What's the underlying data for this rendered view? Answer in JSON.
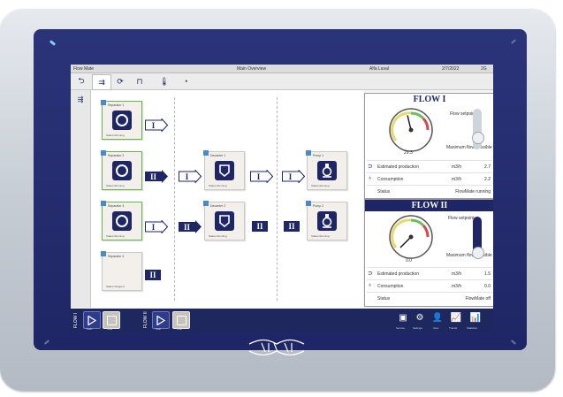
{
  "titlebar": {
    "left": "Flow Mate",
    "center": "Main Overview",
    "user": "Alfa Laval",
    "time": "2/7/2022",
    "signal": "2G"
  },
  "units": [
    {
      "title": "Separator 1",
      "footer": "Status  Running"
    },
    {
      "title": "Separator 2",
      "footer": "Status  Running"
    },
    {
      "title": "Separator 3",
      "footer": "Status  Running"
    },
    {
      "title": "Separator 4",
      "footer": "Status  Stopped"
    },
    {
      "title": "Decanter 1",
      "footer": "Status  Running"
    },
    {
      "title": "Decanter 2",
      "footer": "Status  Running"
    },
    {
      "title": "Pump 1",
      "footer": "Status  Running"
    },
    {
      "title": "Pump 2",
      "footer": "Status  Running"
    }
  ],
  "arrows": {
    "one": "I",
    "two": "II"
  },
  "flow1": {
    "title": "FLOW I",
    "gauge_value": "29.3",
    "gauge_level": 0.45,
    "slider_level": 0.25,
    "slider_top_label": "Flow setpoint",
    "slider_bottom_label": "Maximum flow possible",
    "rows": [
      {
        "icon": "flow-icon",
        "label": "Estimated production",
        "unit": "m3/h",
        "value": "2.7"
      },
      {
        "icon": "consumption-icon",
        "label": "Consumption",
        "unit": "m3/h",
        "value": "2.2"
      },
      {
        "icon": "",
        "label": "Status",
        "unit": "",
        "value": "FlowMate running"
      }
    ]
  },
  "flow2": {
    "title": "FLOW II",
    "gauge_value": "0.0",
    "gauge_level": 0.0,
    "slider_level": 0.0,
    "slider_top_label": "Flow setpoint",
    "slider_bottom_label": "Maximum flow possible",
    "rows": [
      {
        "icon": "flow-icon",
        "label": "Estimated production",
        "unit": "m3/h",
        "value": "1.5"
      },
      {
        "icon": "consumption-icon",
        "label": "Consumption",
        "unit": "m3/h",
        "value": "0.0"
      },
      {
        "icon": "",
        "label": "Status",
        "unit": "",
        "value": "FlowMate off"
      }
    ]
  },
  "bottom": {
    "flow1_label": "FLOW I",
    "flow2_label": "FLOW II",
    "start_label": "Start",
    "stop_label": "Stop",
    "right": [
      {
        "icon": "service-icon",
        "label": "Service"
      },
      {
        "icon": "settings-icon",
        "label": "Settings"
      },
      {
        "icon": "user-icon",
        "label": "User"
      },
      {
        "icon": "trend-icon",
        "label": "Trends"
      },
      {
        "icon": "chart-icon",
        "label": "Statistics"
      }
    ]
  },
  "colors": {
    "navy": "#1e2666",
    "green": "#67b44a",
    "accent": "#4a8ac9"
  }
}
